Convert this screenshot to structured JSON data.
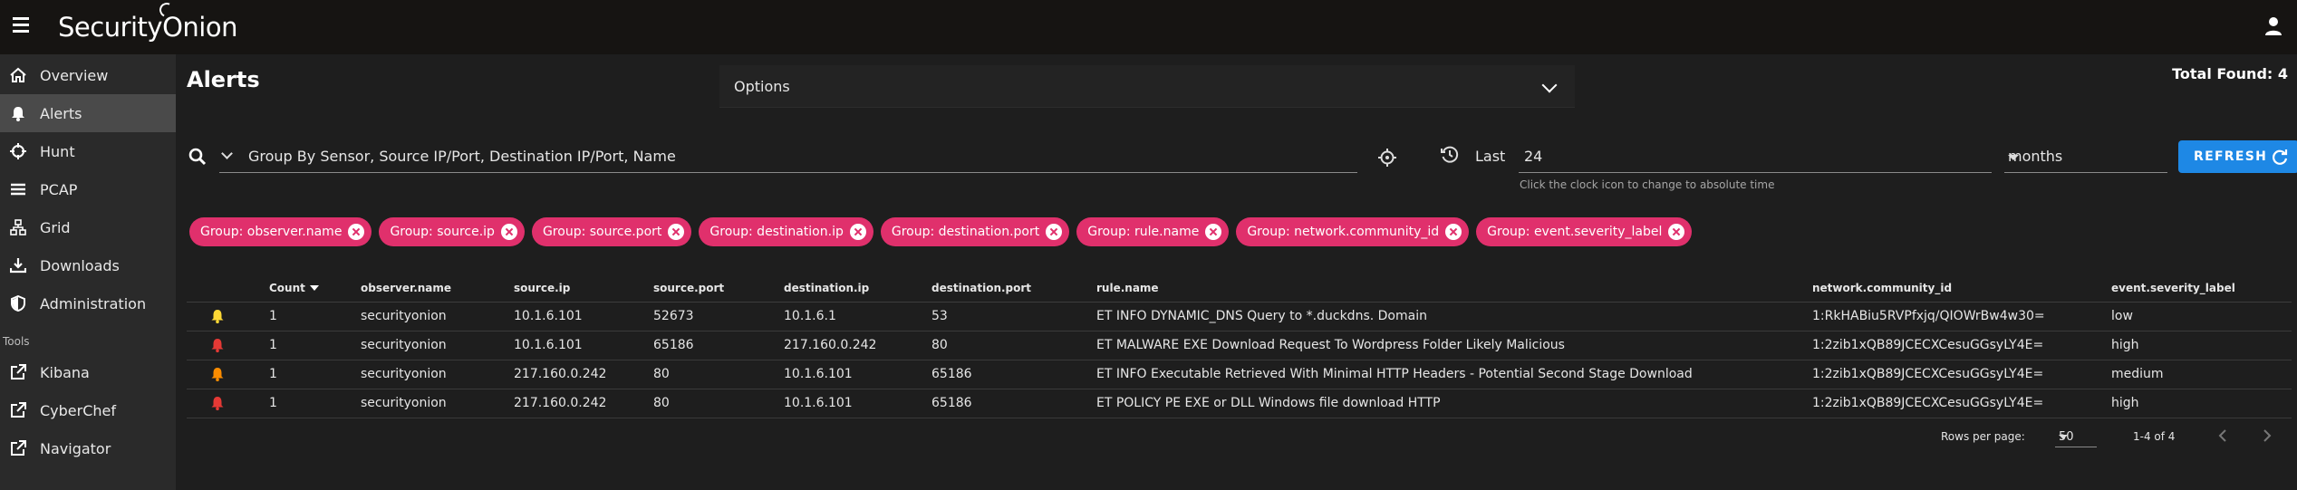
{
  "app": {
    "logo_text_1": "Security",
    "logo_text_2": "Onion"
  },
  "sidebar": {
    "items": [
      {
        "label": "Overview",
        "icon": "home-icon"
      },
      {
        "label": "Alerts",
        "icon": "bell-icon",
        "active": true
      },
      {
        "label": "Hunt",
        "icon": "crosshairs-icon"
      },
      {
        "label": "PCAP",
        "icon": "list-icon"
      },
      {
        "label": "Grid",
        "icon": "sitemap-icon"
      },
      {
        "label": "Downloads",
        "icon": "download-icon"
      },
      {
        "label": "Administration",
        "icon": "shield-icon"
      }
    ],
    "tools_label": "Tools",
    "tools": [
      {
        "label": "Kibana",
        "icon": "external-link-icon"
      },
      {
        "label": "CyberChef",
        "icon": "external-link-icon"
      },
      {
        "label": "Navigator",
        "icon": "external-link-icon"
      }
    ]
  },
  "header": {
    "title": "Alerts",
    "options_label": "Options",
    "total_found": "Total Found: 4"
  },
  "query": {
    "text": "Group By Sensor, Source IP/Port, Destination IP/Port, Name",
    "last_label": "Last",
    "last_value": "24",
    "unit": "months",
    "hint": "Click the clock icon to change to absolute time",
    "refresh_label": "REFRESH"
  },
  "chips": [
    "Group: observer.name",
    "Group: source.ip",
    "Group: source.port",
    "Group: destination.ip",
    "Group: destination.port",
    "Group: rule.name",
    "Group: network.community_id",
    "Group: event.severity_label"
  ],
  "table": {
    "headers": [
      "",
      "Count",
      "observer.name",
      "source.ip",
      "source.port",
      "destination.ip",
      "destination.port",
      "rule.name",
      "network.community_id",
      "event.severity_label"
    ],
    "rows": [
      {
        "severity_color": "#fdd835",
        "count": "1",
        "observer": "securityonion",
        "src_ip": "10.1.6.101",
        "src_port": "52673",
        "dst_ip": "10.1.6.1",
        "dst_port": "53",
        "rule": "ET INFO DYNAMIC_DNS Query to *.duckdns. Domain",
        "community_id": "1:RkHABiu5RVPfxjq/QIOWrBw4w30=",
        "severity": "low"
      },
      {
        "severity_color": "#e53935",
        "count": "1",
        "observer": "securityonion",
        "src_ip": "10.1.6.101",
        "src_port": "65186",
        "dst_ip": "217.160.0.242",
        "dst_port": "80",
        "rule": "ET MALWARE EXE Download Request To Wordpress Folder Likely Malicious",
        "community_id": "1:2zib1xQB89JCECXCesuGGsyLY4E=",
        "severity": "high"
      },
      {
        "severity_color": "#fb8c00",
        "count": "1",
        "observer": "securityonion",
        "src_ip": "217.160.0.242",
        "src_port": "80",
        "dst_ip": "10.1.6.101",
        "dst_port": "65186",
        "rule": "ET INFO Executable Retrieved With Minimal HTTP Headers - Potential Second Stage Download",
        "community_id": "1:2zib1xQB89JCECXCesuGGsyLY4E=",
        "severity": "medium"
      },
      {
        "severity_color": "#e53935",
        "count": "1",
        "observer": "securityonion",
        "src_ip": "217.160.0.242",
        "src_port": "80",
        "dst_ip": "10.1.6.101",
        "dst_port": "65186",
        "rule": "ET POLICY PE EXE or DLL Windows file download HTTP",
        "community_id": "1:2zib1xQB89JCECXCesuGGsyLY4E=",
        "severity": "high"
      }
    ]
  },
  "footer": {
    "rows_per_page_label": "Rows per page:",
    "rows_per_page": "50",
    "range": "1-4 of 4"
  }
}
